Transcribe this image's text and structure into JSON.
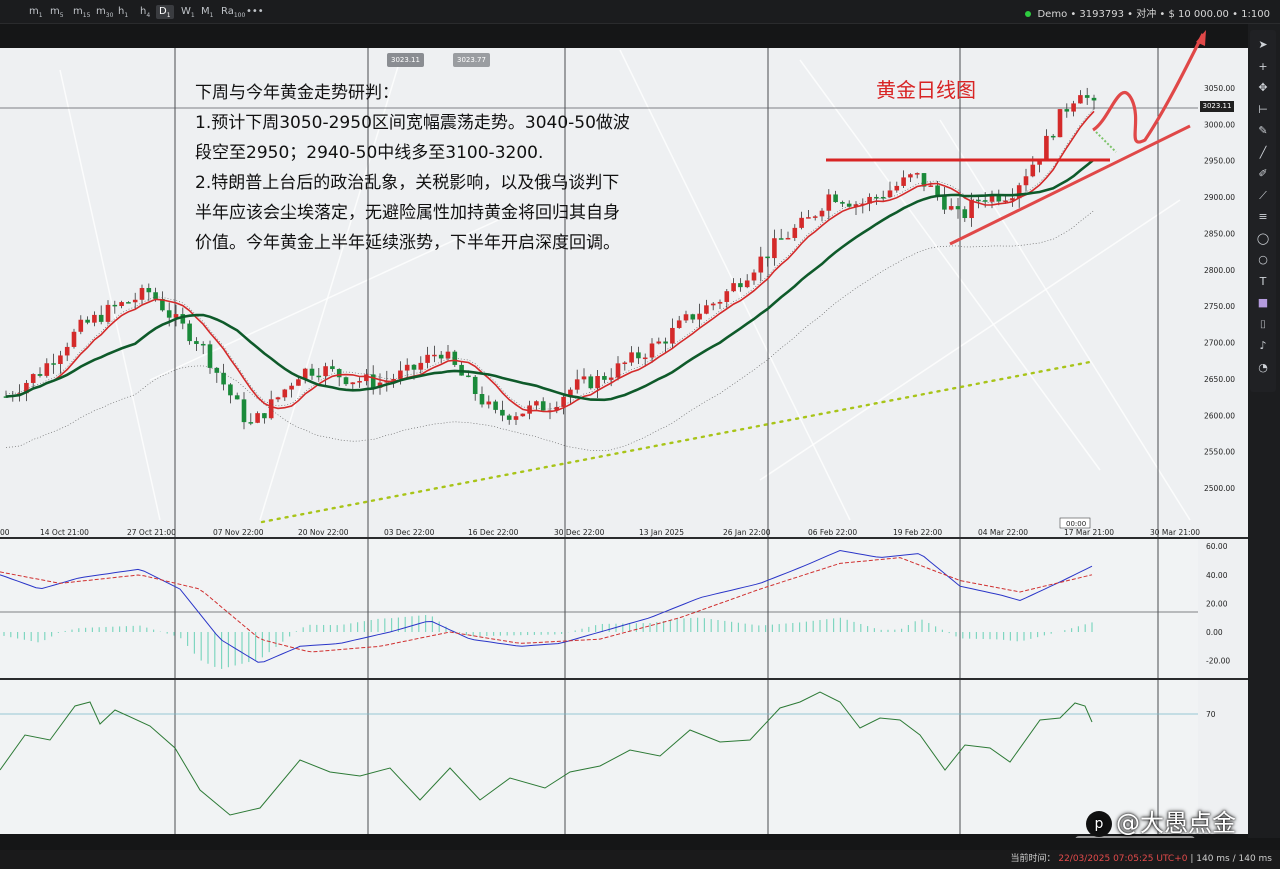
{
  "toolbar": {
    "timeframes": [
      {
        "label": "m",
        "sub": "1"
      },
      {
        "label": "m",
        "sub": "5"
      },
      {
        "label": "m",
        "sub": "15"
      },
      {
        "label": "m",
        "sub": "30"
      },
      {
        "label": "h",
        "sub": "1"
      },
      {
        "label": "h",
        "sub": "4"
      },
      {
        "label": "D",
        "sub": "1"
      },
      {
        "label": "W",
        "sub": "1"
      },
      {
        "label": "M",
        "sub": "1"
      },
      {
        "label": "Ra",
        "sub": "100"
      }
    ],
    "active_timeframe": "D",
    "more_label": "•••",
    "account": "Demo • 3193793 • 对冲 • $ 10 000.00 • 1:100"
  },
  "annotation": {
    "lines": [
      "下周与今年黄金走势研判：",
      "1.预计下周3050-2950区间宽幅震荡走势。3040-50做波",
      "段空至2950；2940-50中线多至3100-3200.",
      "2.特朗普上台后的政治乱象，关税影响，以及俄乌谈判下",
      "半年应该会尘埃落定，无避险属性加持黄金将回归其自身",
      "价值。今年黄金上半年延续涨势，下半年开启深度回调。"
    ],
    "chart_title": "黄金日线图"
  },
  "quote_panel": {
    "bid": "3023.11",
    "ask": "3023.77"
  },
  "price_axis": {
    "ticks": [
      "3050.00",
      "3000.00",
      "2950.00",
      "2900.00",
      "2850.00",
      "2800.00",
      "2750.00",
      "2700.00",
      "2650.00",
      "2600.00",
      "2550.00",
      "2500.00"
    ],
    "current": "3023.11"
  },
  "time_axis": {
    "ticks": [
      "00",
      "14 Oct 21:00",
      "27 Oct 21:00",
      "07 Nov 22:00",
      "20 Nov 22:00",
      "03 Dec 22:00",
      "16 Dec 22:00",
      "30 Dec 22:00",
      "13 Jan 2025",
      "26 Jan 22:00",
      "06 Feb 22:00",
      "19 Feb 22:00",
      "04 Mar 22:00",
      "17 Mar 21:00",
      "30 Mar 21:00"
    ],
    "cursor_label": "00:00"
  },
  "macd_axis": {
    "ticks": [
      "60.00",
      "40.00",
      "20.00",
      "0.00",
      "-20.00"
    ]
  },
  "rsi_axis": {
    "ticks": [
      "70"
    ]
  },
  "watermark": {
    "icon": "p",
    "text": "@大愚点金"
  },
  "status_bar": {
    "label": "当前时间：",
    "time": "22/03/2025 07:05:25",
    "tz": "UTC+0",
    "latency": "| 140 ms / 140 ms"
  },
  "colors": {
    "bull": "#d42a2a",
    "bear": "#1a8a3a",
    "ma_fast": "#d42a2a",
    "ma_slow": "#0e5a2a",
    "trend_dots": "#a8c418",
    "annotation": "#d82424"
  },
  "chart_data": {
    "type": "candlestick",
    "instrument_note": "gold daily",
    "x": [
      "14 Oct 21:00",
      "27 Oct 21:00",
      "07 Nov 22:00",
      "20 Nov 22:00",
      "03 Dec 22:00",
      "16 Dec 22:00",
      "30 Dec 22:00",
      "13 Jan 2025",
      "26 Jan 22:00",
      "06 Feb 22:00",
      "19 Feb 22:00",
      "04 Mar 22:00",
      "17 Mar 21:00"
    ],
    "close_approx": [
      2650,
      2745,
      2660,
      2630,
      2650,
      2600,
      2615,
      2690,
      2780,
      2880,
      2910,
      2915,
      3023
    ],
    "ylim": [
      2470,
      3080
    ],
    "levels": [
      2950
    ],
    "macd_ylim": [
      -30,
      65
    ],
    "rsi_level": 70
  }
}
